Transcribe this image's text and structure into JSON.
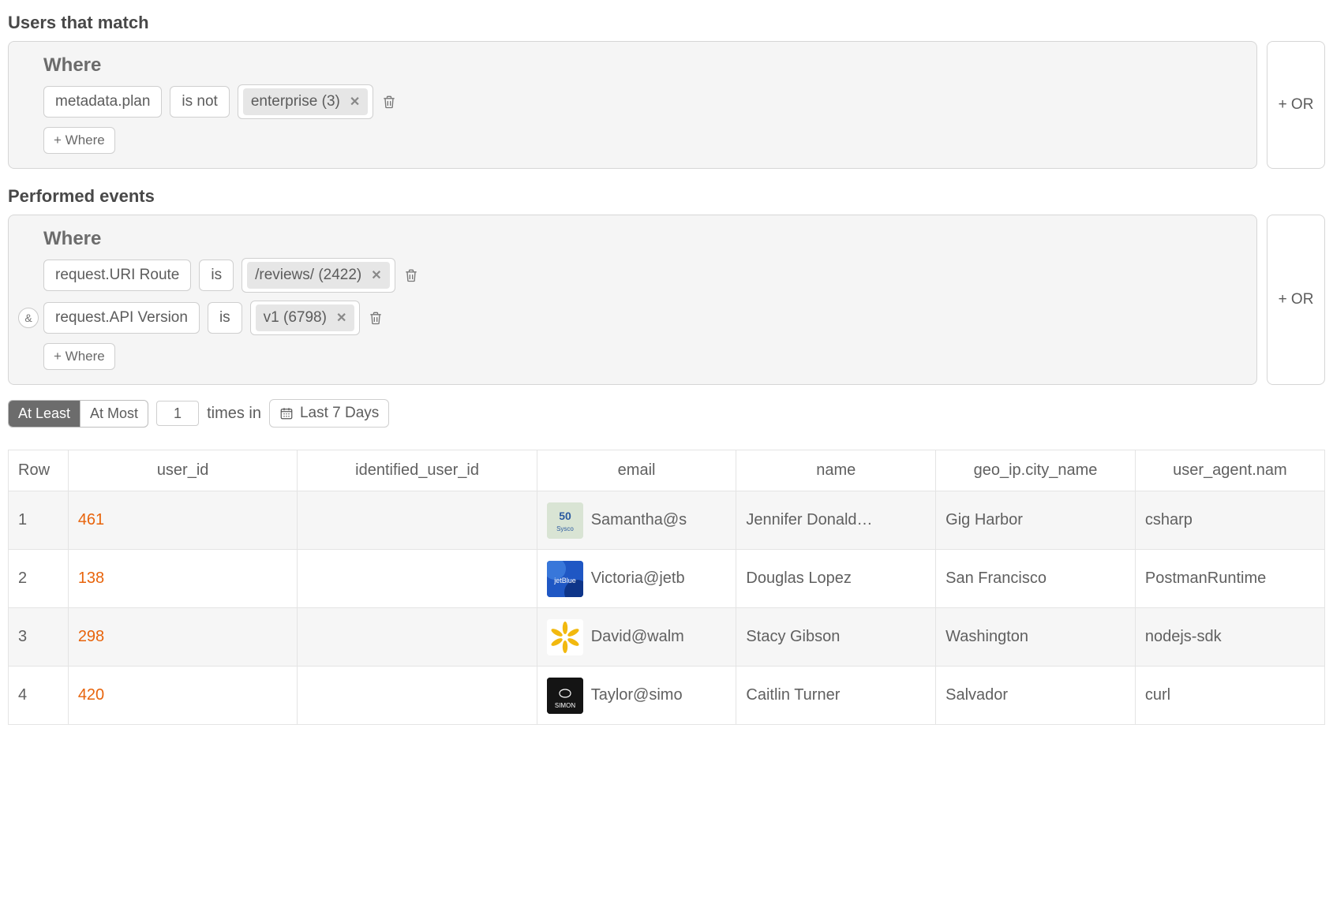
{
  "sections": {
    "usersMatch": "Users that match",
    "performedEvents": "Performed events"
  },
  "labels": {
    "where": "Where",
    "addWhere": "+ Where",
    "or": "+ OR",
    "and": "&",
    "atLeast": "At Least",
    "atMost": "At Most",
    "timesIn": "times in",
    "last7": "Last 7 Days"
  },
  "usersClause": {
    "conditions": [
      {
        "field": "metadata.plan",
        "op": "is not",
        "chip": "enterprise (3)"
      }
    ]
  },
  "eventsClause": {
    "conditions": [
      {
        "field": "request.URI Route",
        "op": "is",
        "chip": "/reviews/ (2422)",
        "andBefore": false
      },
      {
        "field": "request.API Version",
        "op": "is",
        "chip": "v1 (6798)",
        "andBefore": true
      }
    ]
  },
  "threshold": {
    "mode": "atLeast",
    "count": "1"
  },
  "table": {
    "headers": [
      "Row",
      "user_id",
      "identified_user_id",
      "email",
      "name",
      "geo_ip.city_name",
      "user_agent.nam"
    ],
    "rows": [
      {
        "row": "1",
        "user_id": "461",
        "identified_user_id": "",
        "email": "Samantha@s",
        "name": "Jennifer Donald…",
        "city": "Gig Harbor",
        "ua": "csharp",
        "avatarColor": "#d9e4d4"
      },
      {
        "row": "2",
        "user_id": "138",
        "identified_user_id": "",
        "email": "Victoria@jetb",
        "name": "Douglas Lopez",
        "city": "San Francisco",
        "ua": "PostmanRuntime",
        "avatarColor": "#1f57c4"
      },
      {
        "row": "3",
        "user_id": "298",
        "identified_user_id": "",
        "email": "David@walm",
        "name": "Stacy Gibson",
        "city": "Washington",
        "ua": "nodejs-sdk",
        "avatarColor": "#ffffff"
      },
      {
        "row": "4",
        "user_id": "420",
        "identified_user_id": "",
        "email": "Taylor@simo",
        "name": "Caitlin Turner",
        "city": "Salvador",
        "ua": "curl",
        "avatarColor": "#141414"
      }
    ]
  }
}
